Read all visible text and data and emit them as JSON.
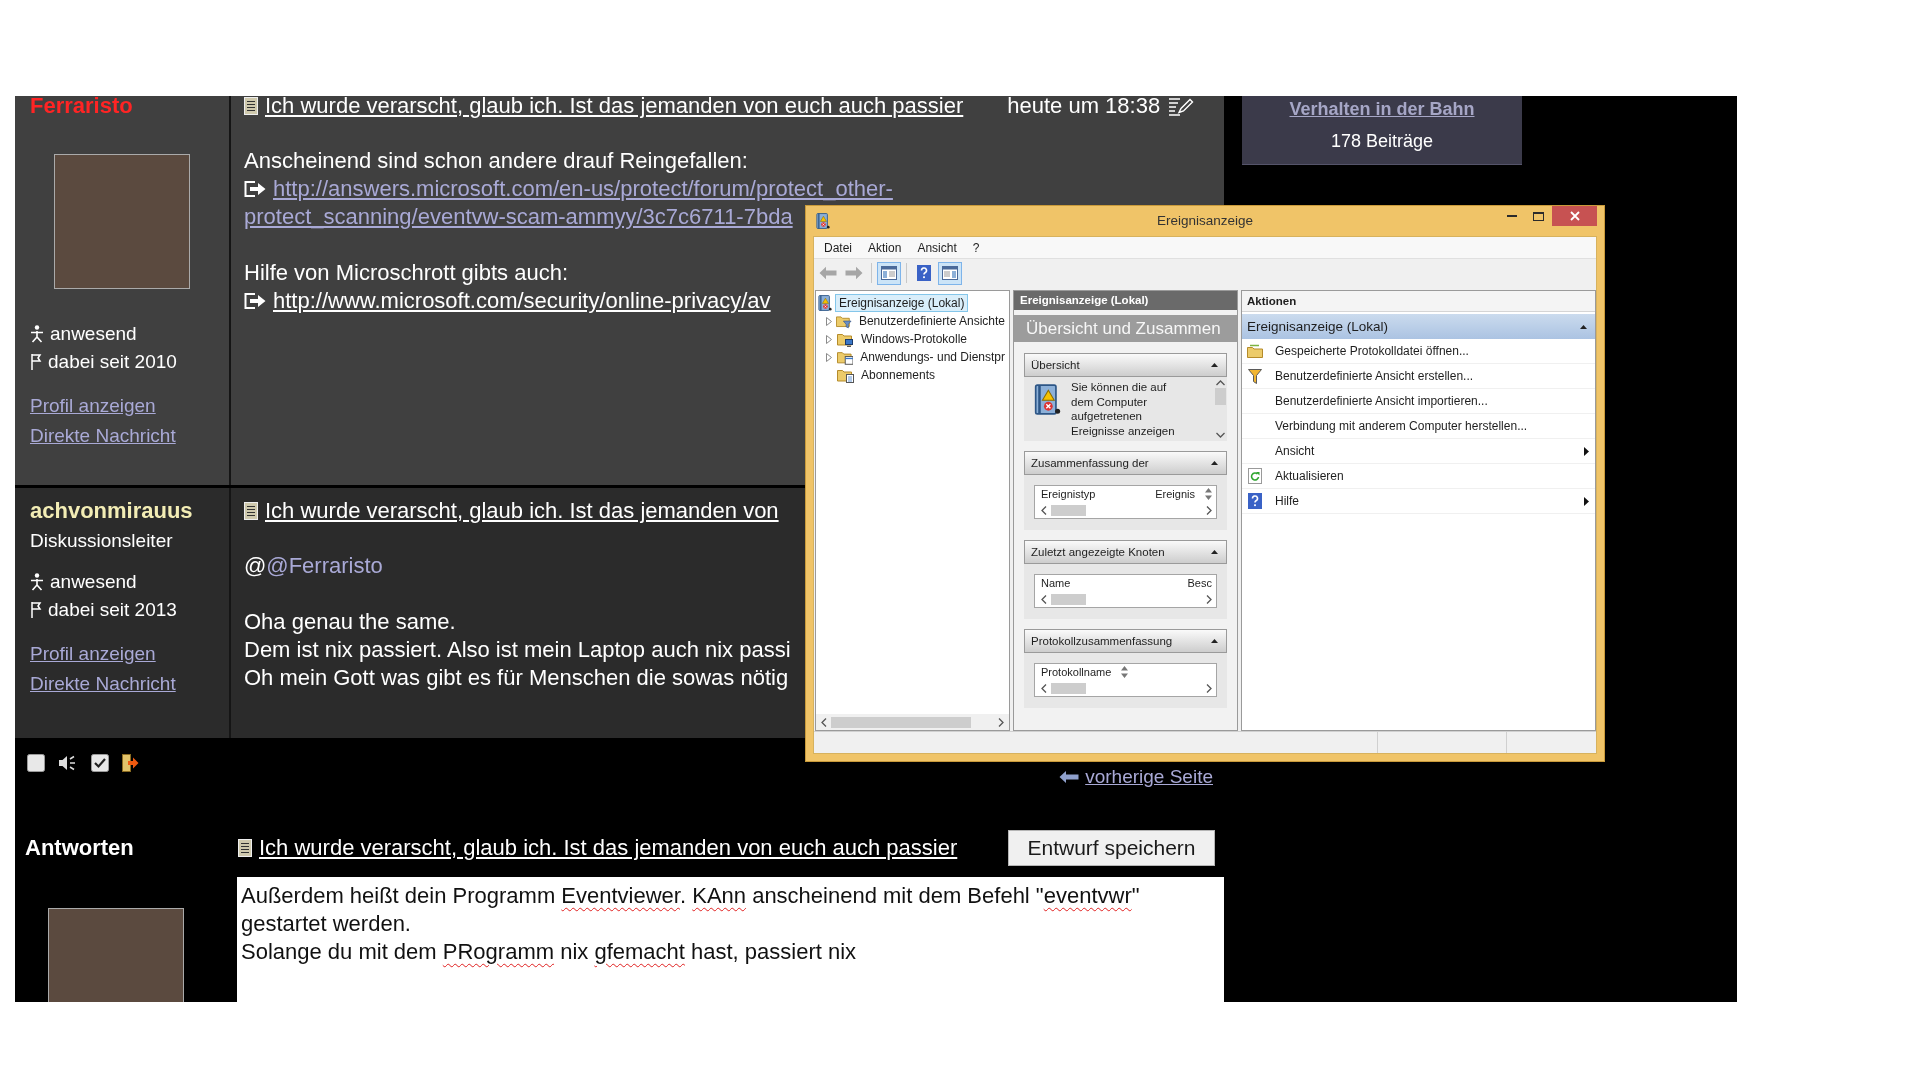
{
  "posts": [
    {
      "highlighted": true,
      "author": {
        "name": "Ferraristo",
        "color": "#ff2424"
      },
      "avatar": true,
      "status": "anwesend",
      "member_since": "dabei seit 2010",
      "links": [
        "Profil anzeigen",
        "Direkte Nachricht"
      ],
      "title": "Ich wurde verarscht, glaub ich. Ist das jemanden von euch auch passier",
      "date": "heute um 18:38",
      "body": [
        [
          {
            "kind": "text",
            "text": "Anscheinend sind schon andere drauf Reingefallen:"
          },
          {
            "kind": "link",
            "visited": true,
            "lines": [
              "http://answers.microsoft.com/en-us/protect/forum/protect_other-",
              "protect_scanning/eventvw-scam-ammyy/3c7c6711-7bda"
            ]
          }
        ],
        [
          {
            "kind": "text",
            "text": "Hilfe von Microschrott gibts auch:"
          },
          {
            "kind": "link",
            "visited": false,
            "lines": [
              "http://www.microsoft.com/security/online-privacy/av"
            ]
          }
        ]
      ]
    },
    {
      "highlighted": false,
      "author": {
        "name": "achvonmirauus",
        "color": "#f3edb5"
      },
      "rank": "Diskussionsleiter",
      "avatar": false,
      "status": "anwesend",
      "member_since": "dabei seit 2013",
      "links": [
        "Profil anzeigen",
        "Direkte Nachricht"
      ],
      "title": "Ich wurde verarscht, glaub ich. Ist das jemanden von",
      "body": [
        [
          {
            "kind": "mention",
            "prefix": "@",
            "link": "@Ferraristo"
          }
        ],
        [
          {
            "kind": "text",
            "text": "Oha genau the same."
          },
          {
            "kind": "text",
            "text": "Dem ist nix passiert. Also ist mein Laptop auch nix passi"
          },
          {
            "kind": "text",
            "text": "Oh mein Gott was gibt es für Menschen die sowas nötig"
          }
        ]
      ]
    }
  ],
  "sidebar_box": {
    "link": "Verhalten in der Bahn",
    "count": "178 Beiträge"
  },
  "pager": {
    "previous": "vorherige Seite"
  },
  "reply": {
    "heading": "Antworten",
    "title": "Ich wurde verarscht, glaub ich. Ist das jemanden von euch auch passier",
    "button": "Entwurf speichern",
    "value": [
      [
        {
          "text": "Außerdem heißt dein Programm ",
          "misspelled": false
        },
        {
          "text": "Eventviewer",
          "misspelled": true
        },
        {
          "text": ". ",
          "misspelled": false
        },
        {
          "text": "KAnn",
          "misspelled": true
        },
        {
          "text": " anscheinend mit dem Befehl \"",
          "misspelled": false
        },
        {
          "text": "eventvwr",
          "misspelled": true
        },
        {
          "text": "\" gestartet werden.",
          "misspelled": false
        }
      ],
      [
        {
          "text": "Solange du mit dem ",
          "misspelled": false
        },
        {
          "text": "PRogramm",
          "misspelled": true
        },
        {
          "text": " nix ",
          "misspelled": false
        },
        {
          "text": "gfemacht",
          "misspelled": true
        },
        {
          "text": " hast, passiert nix",
          "misspelled": false
        }
      ]
    ]
  },
  "event_viewer": {
    "title": "Ereignisanzeige",
    "menu": [
      "Datei",
      "Aktion",
      "Ansicht",
      "?"
    ],
    "toolbar": [
      [
        {
          "kind": "back",
          "pressed": false,
          "disabled": true
        },
        {
          "kind": "forward",
          "pressed": false,
          "disabled": true
        }
      ],
      [
        {
          "kind": "tree_pane",
          "pressed": true,
          "disabled": false
        }
      ],
      [
        {
          "kind": "help",
          "pressed": false,
          "disabled": false
        },
        {
          "kind": "action_pane",
          "pressed": true,
          "disabled": false
        }
      ]
    ],
    "tree": {
      "label": "Ereignisanzeige (Lokal)",
      "selected": true,
      "children": [
        {
          "label": "Benutzerdefinierte Ansichte",
          "selected": false,
          "expanded": false,
          "expandable": true
        },
        {
          "label": "Windows-Protokolle",
          "selected": false,
          "expanded": false,
          "expandable": true
        },
        {
          "label": "Anwendungs- und Dienstpr",
          "selected": false,
          "expanded": false,
          "expandable": true
        },
        {
          "label": "Abonnements",
          "selected": false,
          "expanded": false,
          "expandable": false
        }
      ]
    },
    "center": {
      "header": "Ereignisanzeige (Lokal)",
      "banner": "Übersicht und Zusammen",
      "sections": [
        {
          "title": "Übersicht",
          "expanded": true,
          "kind": "text",
          "text": "Sie können die auf dem Computer aufgetretenen Ereignisse anzeigen"
        },
        {
          "title": "Zusammenfassung der",
          "expanded": true,
          "kind": "list",
          "scrollbar": true,
          "columns": [
            "Ereignistyp",
            "Ereignis"
          ]
        },
        {
          "title": "Zuletzt angezeigte Knoten",
          "expanded": true,
          "kind": "list",
          "scrollbar": false,
          "columns": [
            "Name",
            "Besc"
          ]
        },
        {
          "title": "Protokollzusammenfassung",
          "expanded": true,
          "kind": "list",
          "scrollbar": true,
          "columns": [
            "Protokollname"
          ]
        }
      ]
    },
    "actions": {
      "header": "Aktionen",
      "group": {
        "label": "Ereignisanzeige (Lokal)",
        "expanded": true
      },
      "items": [
        {
          "label": "Gespeicherte Protokolldatei öffnen...",
          "submenu": false
        },
        {
          "label": "Benutzerdefinierte Ansicht erstellen...",
          "submenu": false
        },
        {
          "label": "Benutzerdefinierte Ansicht importieren...",
          "submenu": false
        },
        {
          "label": "Verbindung mit anderem Computer herstellen...",
          "submenu": false
        },
        {
          "label": "Ansicht",
          "submenu": true
        },
        {
          "label": "Aktualisieren",
          "submenu": false
        },
        {
          "label": "Hilfe",
          "submenu": true
        }
      ]
    }
  }
}
